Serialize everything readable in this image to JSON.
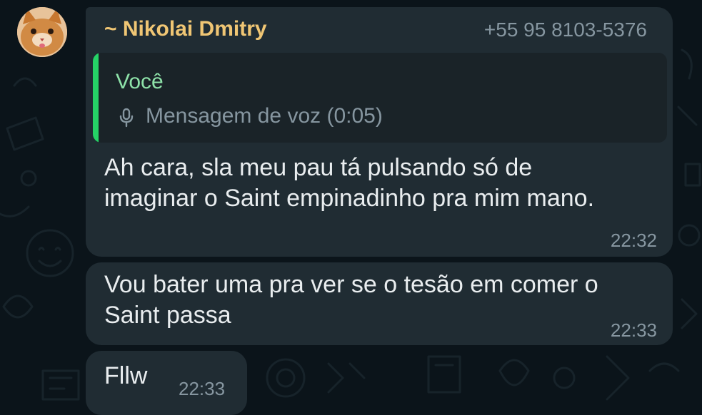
{
  "colors": {
    "background": "#0b141a",
    "bubble": "#202c33",
    "sender_name": "#f0c674",
    "quote_bar": "#25d366",
    "quote_author": "#8ee2a9",
    "meta_text": "#8696a0",
    "message_text": "#e9edef"
  },
  "chat": {
    "avatar_icon": "cat-photo-avatar",
    "messages": [
      {
        "sender_name": "~ Nikolai Dmitry",
        "sender_phone": "+55 95 8103-5376",
        "reply": {
          "author": "Você",
          "icon": "microphone-icon",
          "text": "Mensagem de voz (0:05)"
        },
        "text": "Ah cara, sla meu pau tá pulsando só de\nimaginar o Saint empinadinho pra mim mano.",
        "time": "22:32"
      },
      {
        "text": "Vou bater uma pra ver se o tesão em comer o\nSaint passa",
        "time": "22:33"
      },
      {
        "text": "Fllw",
        "time": "22:33"
      }
    ]
  }
}
